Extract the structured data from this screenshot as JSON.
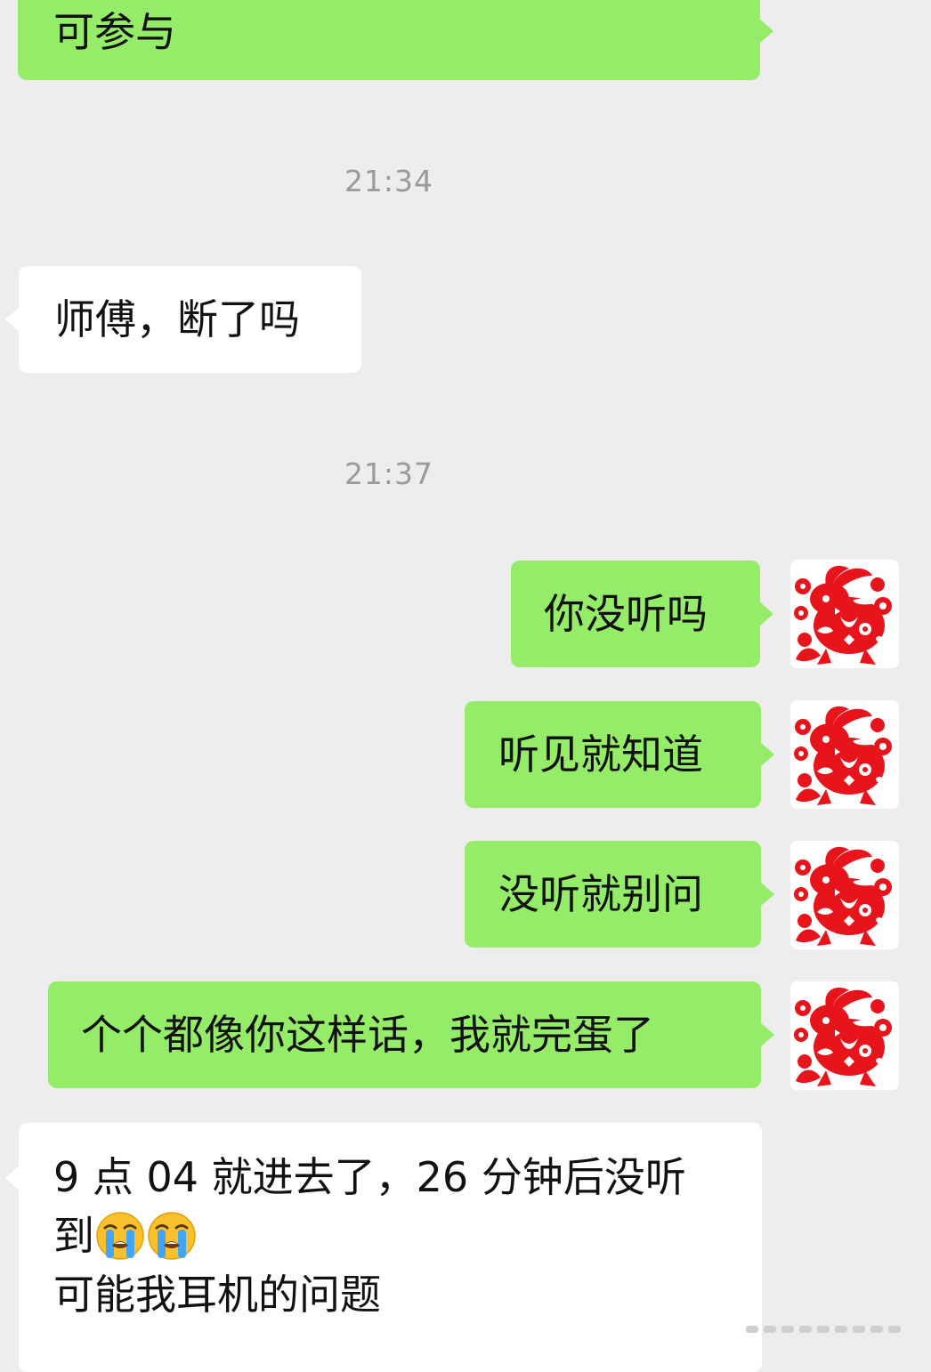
{
  "messages": [
    {
      "side": "out",
      "text": "可参与"
    },
    {
      "type": "time",
      "text": "21:34"
    },
    {
      "side": "in",
      "text": "师傅，断了吗"
    },
    {
      "type": "time",
      "text": "21:37"
    },
    {
      "side": "out",
      "text": "你没听吗"
    },
    {
      "side": "out",
      "text": "听见就知道"
    },
    {
      "side": "out",
      "text": "没听就别问"
    },
    {
      "side": "out",
      "text": "个个都像你这样话，我就完蛋了"
    },
    {
      "side": "in",
      "lines": [
        "9 点 04 就进去了，26 分钟后没听",
        "到",
        "可能我耳机的问题"
      ],
      "emoji": "loudly-crying-face"
    }
  ],
  "colors": {
    "background": "#ededed",
    "outgoing_bubble": "#95ec69",
    "incoming_bubble": "#ffffff",
    "timestamp_text": "#9a9a9a",
    "avatar_papercut": "#e8141c"
  },
  "icons": {
    "avatar": "red-papercut-rabbit-avatar",
    "emoji": "loudly-crying-face"
  }
}
